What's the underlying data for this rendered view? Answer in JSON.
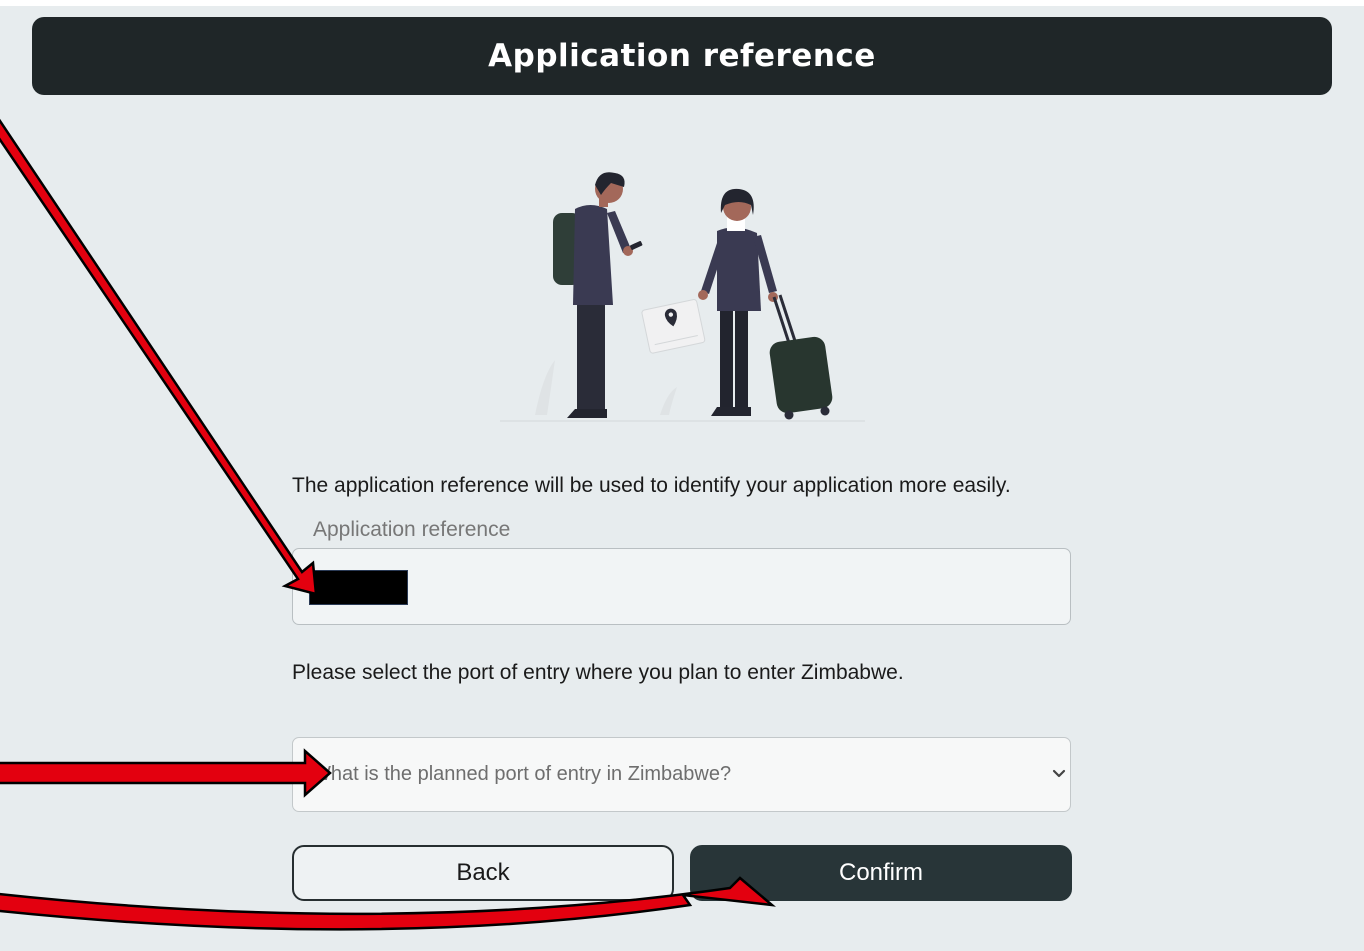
{
  "header": {
    "title": "Application reference"
  },
  "form": {
    "intro_text": "The application reference will be used to identify your application more easily.",
    "reference_label": "Application reference",
    "reference_value": "",
    "port_text": "Please select the port of entry where you plan to enter Zimbabwe.",
    "port_placeholder": "What is the planned port of entry in Zimbabwe?"
  },
  "buttons": {
    "back": "Back",
    "confirm": "Confirm"
  },
  "colors": {
    "header_bg": "#1f2628",
    "confirm_bg": "#283538",
    "annotation_arrow": "#e3000f"
  },
  "icons": {
    "chevron": "chevron-down-icon",
    "illustration": "travelers-illustration"
  }
}
